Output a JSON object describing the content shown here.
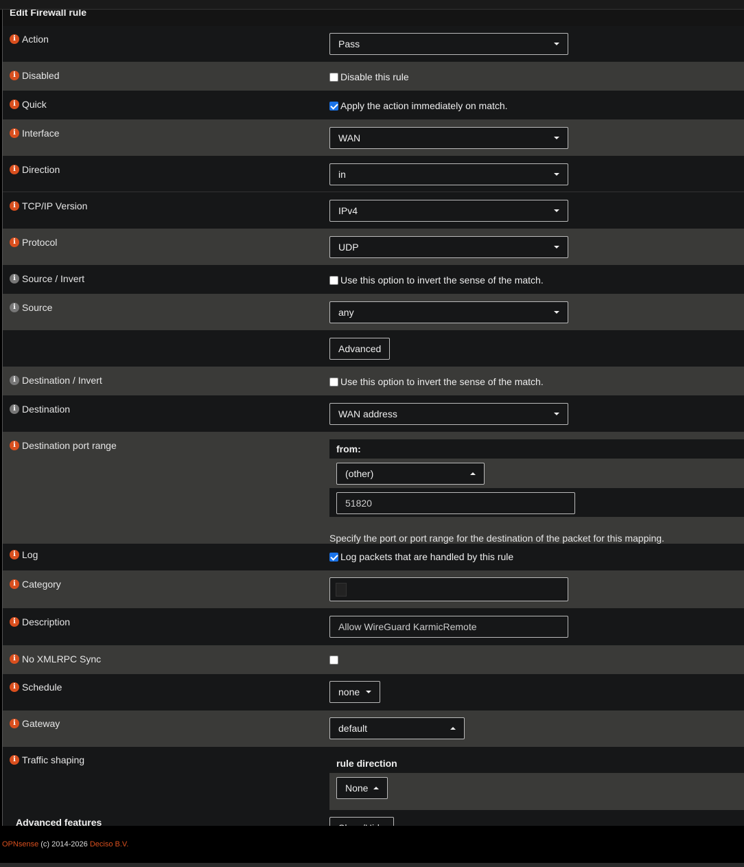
{
  "section_title": "Edit Firewall rule",
  "rows": {
    "action": {
      "label": "Action",
      "value": "Pass"
    },
    "disabled": {
      "label": "Disabled",
      "check_text": "Disable this rule",
      "checked": false
    },
    "quick": {
      "label": "Quick",
      "check_text": "Apply the action immediately on match.",
      "checked": true
    },
    "interface": {
      "label": "Interface",
      "value": "WAN"
    },
    "direction": {
      "label": "Direction",
      "value": "in"
    },
    "ipversion": {
      "label": "TCP/IP Version",
      "value": "IPv4"
    },
    "protocol": {
      "label": "Protocol",
      "value": "UDP"
    },
    "source_invert": {
      "label": "Source / Invert",
      "check_text": "Use this option to invert the sense of the match.",
      "checked": false
    },
    "source": {
      "label": "Source",
      "value": "any",
      "advanced_label": "Advanced"
    },
    "dest_invert": {
      "label": "Destination / Invert",
      "check_text": "Use this option to invert the sense of the match.",
      "checked": false
    },
    "destination": {
      "label": "Destination",
      "value": "WAN address"
    },
    "dest_port": {
      "label": "Destination port range",
      "from_label": "from:",
      "from_select": "(other)",
      "from_value": "51820",
      "help": "Specify the port or port range for the destination of the packet for this mapping."
    },
    "log": {
      "label": "Log",
      "check_text": "Log packets that are handled by this rule",
      "checked": true
    },
    "category": {
      "label": "Category",
      "value": ""
    },
    "description": {
      "label": "Description",
      "value": "Allow WireGuard KarmicRemote"
    },
    "xmlrpc": {
      "label": "No XMLRPC Sync",
      "checked": false
    },
    "schedule": {
      "label": "Schedule",
      "value": "none"
    },
    "gateway": {
      "label": "Gateway",
      "value": "default"
    },
    "shaping": {
      "label": "Traffic shaping",
      "subhead": "rule direction",
      "value": "None"
    },
    "advanced": {
      "label": "Advanced features",
      "button": "Show/Hide"
    }
  },
  "footer": {
    "brand": "OPNsense",
    "copy": " (c) 2014-2026 ",
    "company": "Deciso B.V."
  },
  "colors": {
    "accent": "#d94f1e",
    "info_grey": "#777777",
    "row_dark": "#161718",
    "row_light": "#3a3a38"
  }
}
